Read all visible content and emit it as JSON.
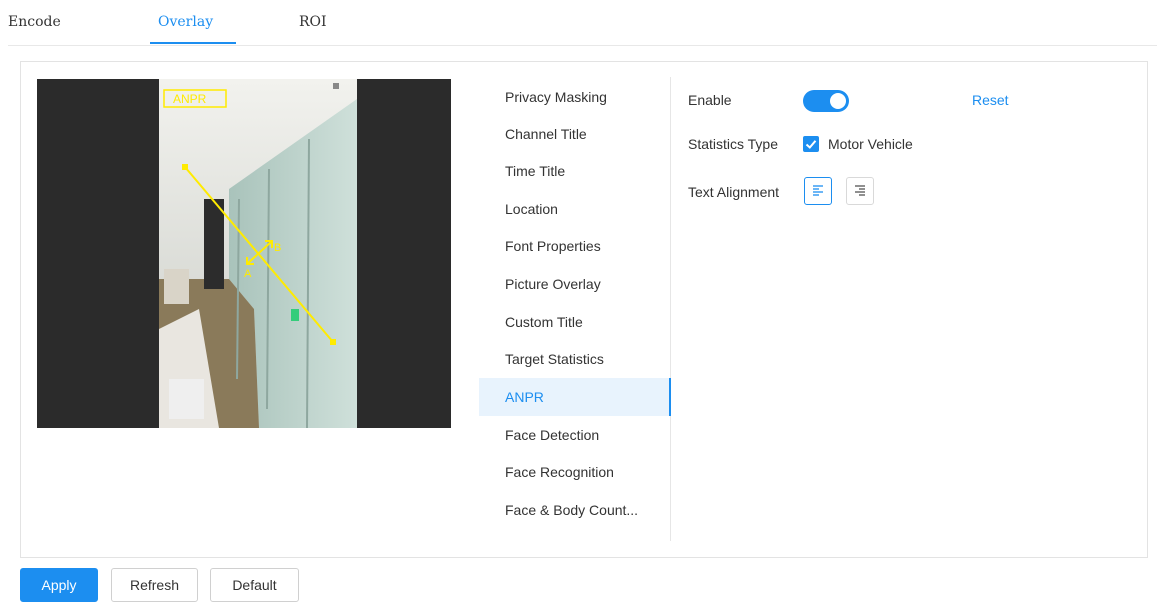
{
  "tabs": [
    {
      "label": "Encode"
    },
    {
      "label": "Overlay"
    },
    {
      "label": "ROI"
    }
  ],
  "preview": {
    "box_label": "ANPR",
    "point_a": "A",
    "point_b": "B"
  },
  "menu": {
    "items": [
      {
        "label": "Privacy Masking"
      },
      {
        "label": "Channel Title"
      },
      {
        "label": "Time Title"
      },
      {
        "label": "Location"
      },
      {
        "label": "Font Properties"
      },
      {
        "label": "Picture Overlay"
      },
      {
        "label": "Custom Title"
      },
      {
        "label": "Target Statistics"
      },
      {
        "label": "ANPR"
      },
      {
        "label": "Face Detection"
      },
      {
        "label": "Face Recognition"
      },
      {
        "label": "Face & Body Count..."
      }
    ],
    "active": "ANPR"
  },
  "form": {
    "enable_label": "Enable",
    "enable_state": true,
    "reset_label": "Reset",
    "statistics_type_label": "Statistics Type",
    "statistics_option": "Motor Vehicle",
    "statistics_checked": true,
    "text_alignment_label": "Text Alignment",
    "alignment_selected": "left"
  },
  "buttons": {
    "apply": "Apply",
    "refresh": "Refresh",
    "default": "Default"
  },
  "colors": {
    "accent": "#1c8ef0",
    "rule_line": "#ffeb00"
  }
}
